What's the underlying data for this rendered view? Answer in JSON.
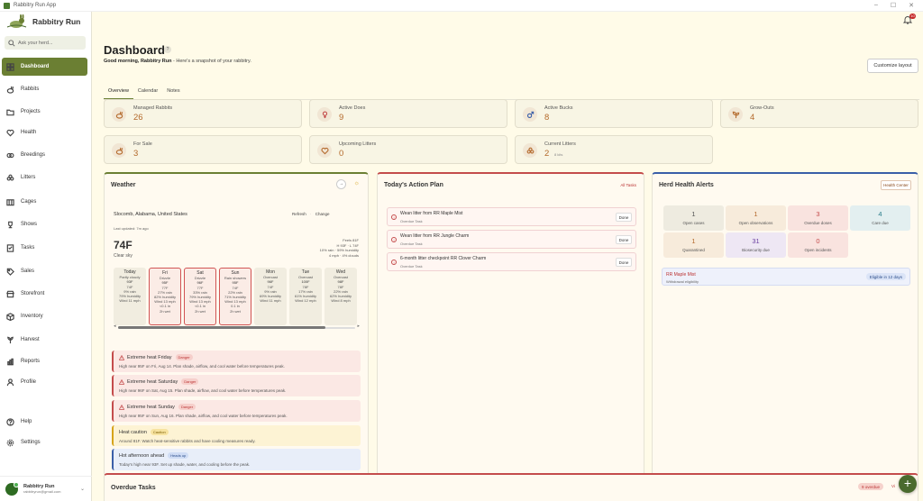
{
  "window": {
    "title": "Rabbitry Run App"
  },
  "brand": {
    "name": "Rabbitry Run"
  },
  "search": {
    "placeholder": "Ask your herd..."
  },
  "nav": [
    {
      "label": "Dashboard",
      "icon": "dashboard-icon"
    },
    {
      "label": "Rabbits",
      "icon": "rabbit-icon"
    },
    {
      "label": "Projects",
      "icon": "folder-icon"
    },
    {
      "label": "Health",
      "icon": "heart-icon"
    },
    {
      "label": "Breedings",
      "icon": "breeding-icon"
    },
    {
      "label": "Litters",
      "icon": "litter-icon"
    },
    {
      "label": "Cages",
      "icon": "cage-icon"
    },
    {
      "label": "Shows",
      "icon": "trophy-icon"
    },
    {
      "label": "Tasks",
      "icon": "checklist-icon"
    },
    {
      "label": "Sales",
      "icon": "sales-icon"
    },
    {
      "label": "Storefront",
      "icon": "store-icon"
    },
    {
      "label": "Inventory",
      "icon": "box-icon"
    },
    {
      "label": "Harvest",
      "icon": "harvest-icon"
    },
    {
      "label": "Reports",
      "icon": "report-icon"
    },
    {
      "label": "Profile",
      "icon": "person-icon"
    },
    {
      "label": "Help",
      "icon": "help-icon"
    },
    {
      "label": "Settings",
      "icon": "gear-icon"
    }
  ],
  "user": {
    "name": "Rabbitry Run",
    "email": "rabbitryrun@gmail.com"
  },
  "notifications": {
    "count": "10"
  },
  "header": {
    "title": "Dashboard",
    "greeting_bold": "Good morning, Rabbitry Run",
    "greeting_rest": " - Here's a snapshot of your rabbitry.",
    "customize_label": "Customize layout"
  },
  "tabs": [
    "Overview",
    "Calendar",
    "Notes"
  ],
  "stats": [
    {
      "label": "Managed Rabbits",
      "value": "26",
      "sub": "",
      "icon": "rabbit-icon"
    },
    {
      "label": "Active Does",
      "value": "9",
      "sub": "",
      "icon": "female-icon"
    },
    {
      "label": "Active Bucks",
      "value": "8",
      "sub": "",
      "icon": "male-icon"
    },
    {
      "label": "Grow-Outs",
      "value": "4",
      "sub": "",
      "icon": "sprout-icon"
    },
    {
      "label": "For Sale",
      "value": "3",
      "sub": "",
      "icon": "sale-icon"
    },
    {
      "label": "Upcoming Litters",
      "value": "0",
      "sub": "",
      "icon": "heart-icon"
    },
    {
      "label": "Current Litters",
      "value": "2",
      "sub": "8 kits",
      "icon": "litter-icon"
    }
  ],
  "weather": {
    "title": "Weather",
    "location": "Slocomb, Alabama, United States",
    "refresh": "Refresh",
    "change": "Change",
    "updated": "Last updated: 7m ago",
    "temp": "74F",
    "condition": "Clear sky",
    "right": [
      "Feels 81F",
      "H 93F · L 74F",
      "10% rain · 59% humidity",
      "4 mph · 4% clouds"
    ],
    "days": [
      {
        "name": "Today",
        "cond": "Partly cloudy",
        "hi": "93F",
        "lo": "74F",
        "rain": "9% rain",
        "hum": "79% humidity",
        "wind": "Wind 11 mph",
        "extra1": "",
        "extra2": "",
        "alert": false
      },
      {
        "name": "Fri",
        "cond": "Drizzle",
        "hi": "95F",
        "lo": "77F",
        "rain": "27% rain",
        "hum": "82% humidity",
        "wind": "Wind 13 mph",
        "extra1": "<0.1 in",
        "extra2": "2h wet",
        "alert": true
      },
      {
        "name": "Sat",
        "cond": "Drizzle",
        "hi": "96F",
        "lo": "77F",
        "rain": "33% rain",
        "hum": "79% humidity",
        "wind": "Wind 13 mph",
        "extra1": "<0.1 in",
        "extra2": "2h wet",
        "alert": true
      },
      {
        "name": "Sun",
        "cond": "Rain showers",
        "hi": "95F",
        "lo": "74F",
        "rain": "22% rain",
        "hum": "71% humidity",
        "wind": "Wind 13 mph",
        "extra1": "0.1 in",
        "extra2": "2h wet",
        "alert": true
      },
      {
        "name": "Mon",
        "cond": "Overcast",
        "hi": "96F",
        "lo": "74F",
        "rain": "9% rain",
        "hum": "69% humidity",
        "wind": "Wind 11 mph",
        "extra1": "",
        "extra2": "",
        "alert": false
      },
      {
        "name": "Tue",
        "cond": "Overcast",
        "hi": "100F",
        "lo": "78F",
        "rain": "17% rain",
        "hum": "61% humidity",
        "wind": "Wind 12 mph",
        "extra1": "",
        "extra2": "",
        "alert": false
      },
      {
        "name": "Wed",
        "cond": "Overcast",
        "hi": "98F",
        "lo": "78F",
        "rain": "22% rain",
        "hum": "62% humidity",
        "wind": "Wind 8 mph",
        "extra1": "",
        "extra2": "",
        "alert": false
      }
    ],
    "alerts": [
      {
        "title": "Extreme heat Friday",
        "badge": "Danger",
        "kind": "danger",
        "body": "High near 95F on Fri, Aug 14. Plan shade, airflow, and cool water before temperatures peak."
      },
      {
        "title": "Extreme heat Saturday",
        "badge": "Danger",
        "kind": "danger",
        "body": "High near 96F on Sat, Aug 15. Plan shade, airflow, and cool water before temperatures peak."
      },
      {
        "title": "Extreme heat Sunday",
        "badge": "Danger",
        "kind": "danger",
        "body": "High near 95F on Sun, Aug 16. Plan shade, airflow, and cool water before temperatures peak."
      },
      {
        "title": "Heat caution",
        "badge": "Caution",
        "kind": "caution",
        "body": "Around 81F. Watch heat-sensitive rabbits and have cooling measures ready."
      },
      {
        "title": "Hot afternoon ahead",
        "badge": "Heads up",
        "kind": "info",
        "body": "Today's high near 93F. Set up shade, water, and cooling before the peak."
      }
    ]
  },
  "action_plan": {
    "title": "Today's Action Plan",
    "all_tasks": "All Tasks",
    "done_label": "Done",
    "items": [
      {
        "title": "Wean litter from RR Maple Mist",
        "sub": "Overdue Task"
      },
      {
        "title": "Wean litter from RR Jungle Charm",
        "sub": "Overdue Task"
      },
      {
        "title": "6-month litter checkpoint RR Clover Charm",
        "sub": "Overdue Task"
      }
    ]
  },
  "health": {
    "title": "Herd Health Alerts",
    "center": "Health Center",
    "metrics": [
      {
        "value": "1",
        "label": "Open cases",
        "color": "#555555",
        "bg": "#eeebe0"
      },
      {
        "value": "1",
        "label": "Open observations",
        "color": "#b46a2c",
        "bg": "#f7ebdb"
      },
      {
        "value": "3",
        "label": "Overdue doses",
        "color": "#c44c4c",
        "bg": "#f9e3df"
      },
      {
        "value": "4",
        "label": "Care due",
        "color": "#2a7d8a",
        "bg": "#e3eff0"
      },
      {
        "value": "1",
        "label": "Quarantined",
        "color": "#b46a2c",
        "bg": "#f7ebdb"
      },
      {
        "value": "31",
        "label": "Biosecurity due",
        "color": "#6a3fa0",
        "bg": "#eee7f4"
      },
      {
        "value": "0",
        "label": "Open incidents",
        "color": "#c44c4c",
        "bg": "#f9e3df"
      }
    ],
    "withdrawal": {
      "name": "RR Maple Mist",
      "sub": "Withdrawal eligibility",
      "badge": "Eligible in 12 days"
    }
  },
  "overdue": {
    "title": "Overdue Tasks",
    "badge": "9 overdue",
    "view": "Vi"
  },
  "fab": {
    "label": "+"
  },
  "colors": {
    "accent": "#6b7f33",
    "stat_value": "#b46a2c",
    "danger": "#c44c4c",
    "info": "#3a5fa8"
  }
}
